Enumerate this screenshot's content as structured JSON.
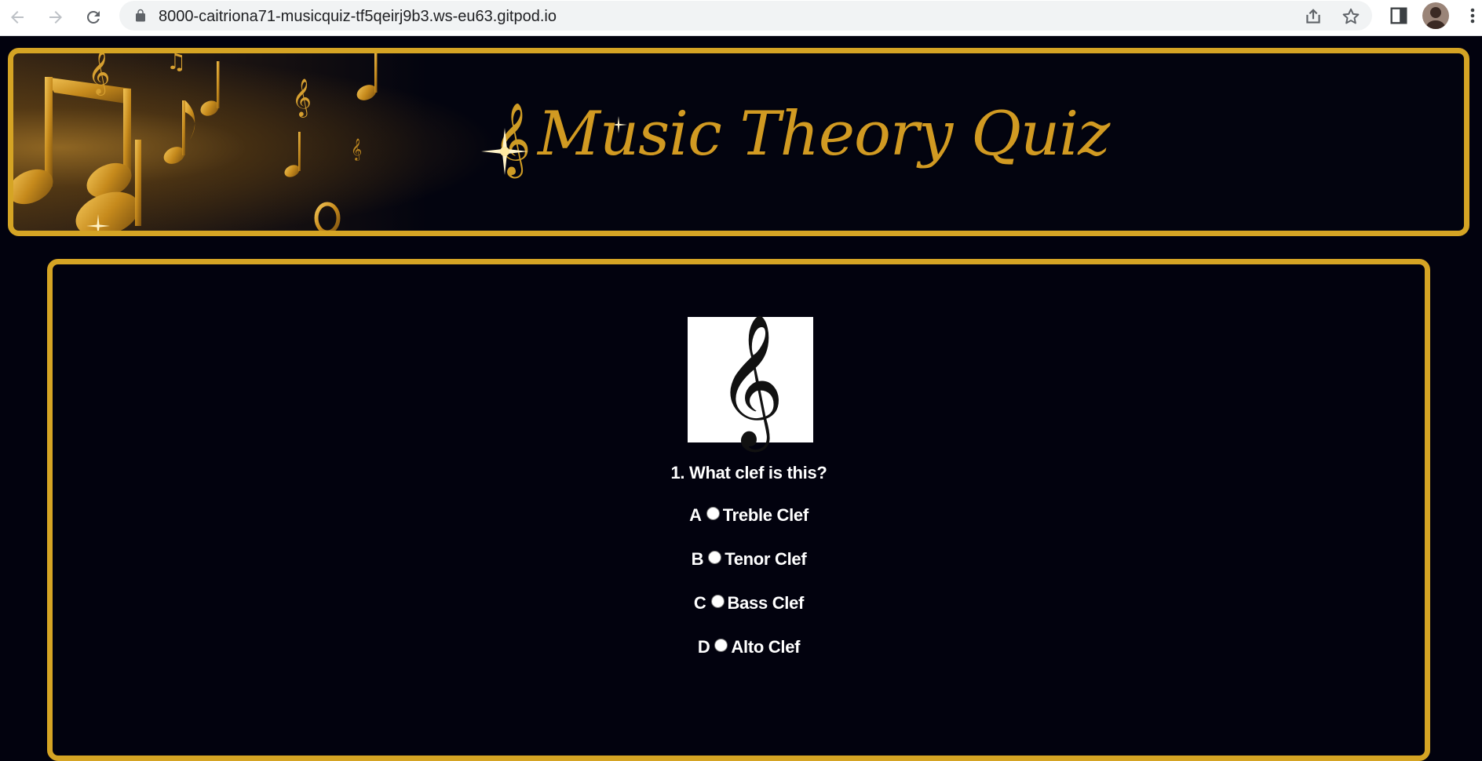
{
  "browser": {
    "url": "8000-caitriona71-musicquiz-tf5qeirj9b3.ws-eu63.gitpod.io",
    "icons": [
      "back-icon",
      "forward-icon",
      "reload-icon",
      "lock-icon",
      "share-icon",
      "star-icon",
      "side-panel-icon",
      "profile-avatar",
      "menu-icon"
    ]
  },
  "header": {
    "title": "Music Theory Quiz",
    "accent_color": "#d5a424",
    "background_color": "#02020e"
  },
  "quiz": {
    "question": "1. What clef is this?",
    "image_icon": "treble-clef-icon",
    "options": [
      {
        "letter": "A",
        "label": "Treble Clef"
      },
      {
        "letter": "B",
        "label": "Tenor Clef"
      },
      {
        "letter": "C",
        "label": "Bass Clef"
      },
      {
        "letter": "D",
        "label": "Alto Clef"
      }
    ]
  }
}
